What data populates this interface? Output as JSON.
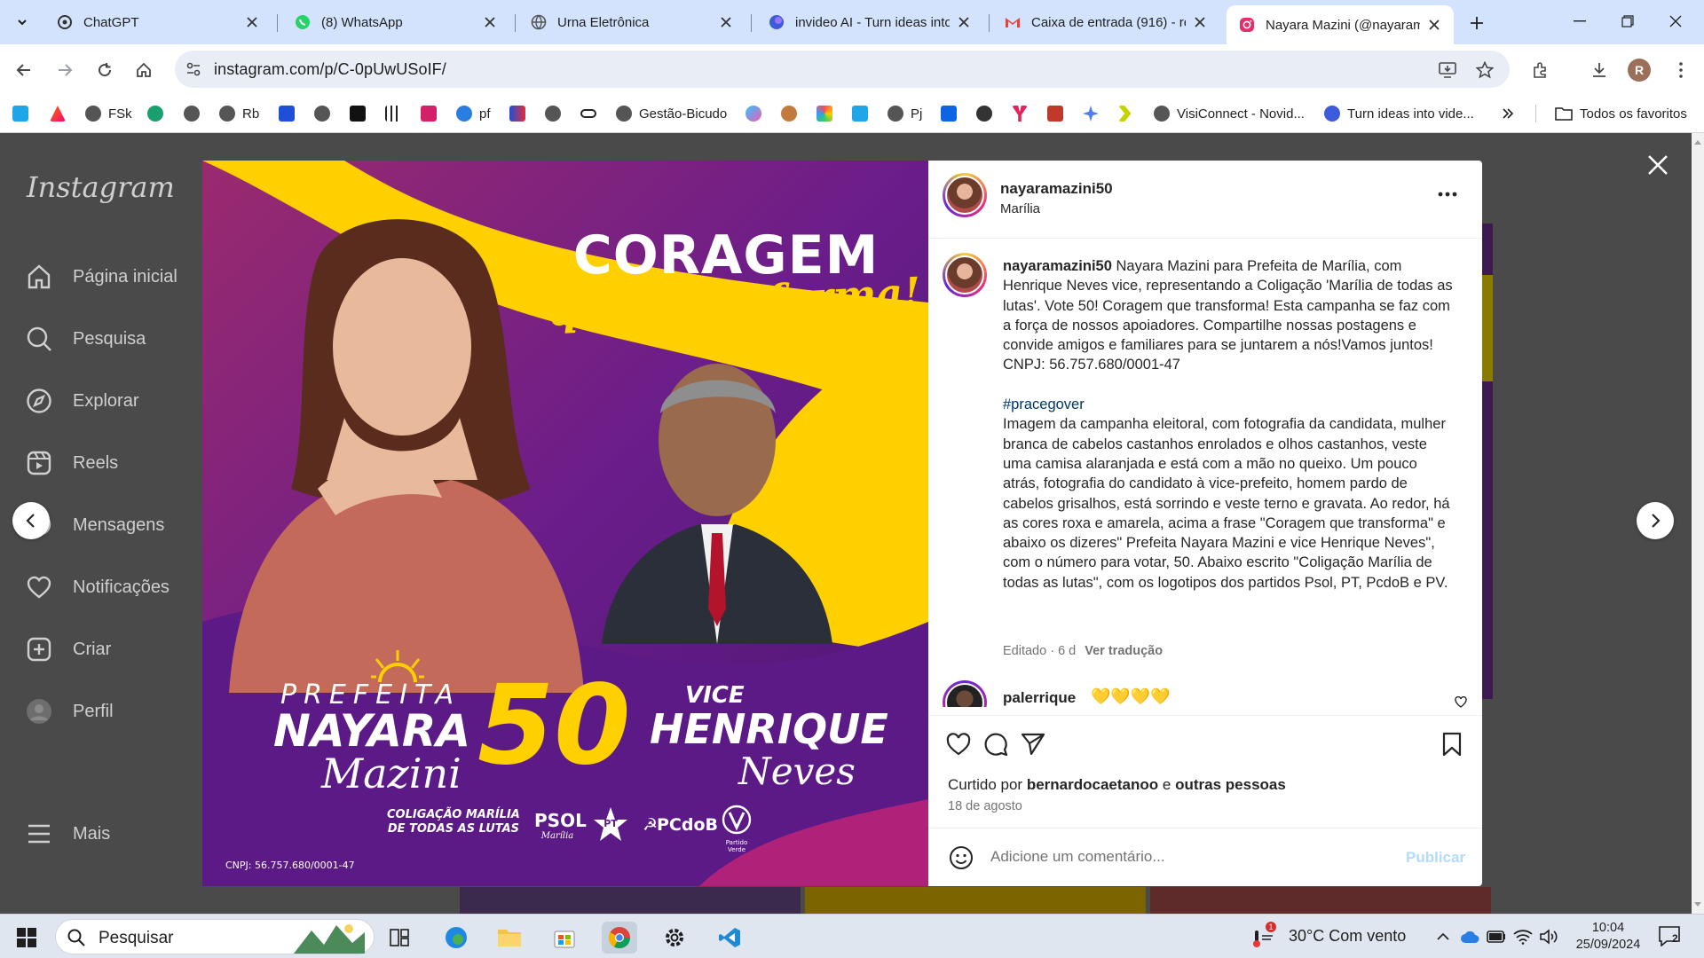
{
  "browser": {
    "tabs": [
      {
        "label": "ChatGPT",
        "icon": "chatgpt-icon"
      },
      {
        "label": "(8) WhatsApp",
        "icon": "whatsapp-icon"
      },
      {
        "label": "Urna Eletrônica",
        "icon": "globe-icon"
      },
      {
        "label": "invideo AI - Turn ideas into",
        "icon": "invideo-icon"
      },
      {
        "label": "Caixa de entrada (916) - re",
        "icon": "gmail-icon"
      },
      {
        "label": "Nayara Mazini (@nayaram",
        "icon": "instagram-icon"
      }
    ],
    "url": "instagram.com/p/C-0pUwUSoIF/",
    "profile_initial": "R"
  },
  "bookmarks": [
    {
      "label": "",
      "icon": "c-app-icon"
    },
    {
      "label": "",
      "icon": "triangle-icon"
    },
    {
      "label": "FSk",
      "icon": "globe-icon"
    },
    {
      "label": "",
      "icon": "cycle-icon"
    },
    {
      "label": "",
      "icon": "globe-icon"
    },
    {
      "label": "Rb",
      "icon": "globe-icon"
    },
    {
      "label": "",
      "icon": "u-icon"
    },
    {
      "label": "",
      "icon": "globe-icon"
    },
    {
      "label": "",
      "icon": "notion-icon"
    },
    {
      "label": "",
      "icon": "grid-icon"
    },
    {
      "label": "",
      "icon": "square-app-icon"
    },
    {
      "label": "pf",
      "icon": "p-icon"
    },
    {
      "label": "",
      "icon": "chart-icon"
    },
    {
      "label": "",
      "icon": "globe-icon"
    },
    {
      "label": "",
      "icon": "link-icon"
    },
    {
      "label": "Gestão-Bicudo",
      "icon": "globe-icon"
    },
    {
      "label": "",
      "icon": "copilot-icon"
    },
    {
      "label": "",
      "icon": "person-icon"
    },
    {
      "label": "",
      "icon": "colorgrid-icon"
    },
    {
      "label": "",
      "icon": "c-app-icon"
    },
    {
      "label": "Pj",
      "icon": "globe-icon"
    },
    {
      "label": "",
      "icon": "trello-icon"
    },
    {
      "label": "",
      "icon": "openai-icon"
    },
    {
      "label": "",
      "icon": "fork-icon"
    },
    {
      "label": "",
      "icon": "cap-icon"
    },
    {
      "label": "",
      "icon": "gemini-icon"
    },
    {
      "label": "",
      "icon": "chevrons-icon"
    },
    {
      "label": "VisiConnect - Novid...",
      "icon": "globe-icon"
    },
    {
      "label": "Turn ideas into vide...",
      "icon": "invideo-icon"
    }
  ],
  "bookmarks_all": "Todos os favoritos",
  "instagram": {
    "logo": "Instagram",
    "nav": [
      {
        "label": "Página inicial",
        "icon": "home-icon"
      },
      {
        "label": "Pesquisa",
        "icon": "search-icon"
      },
      {
        "label": "Explorar",
        "icon": "compass-icon"
      },
      {
        "label": "Reels",
        "icon": "reels-icon"
      },
      {
        "label": "Mensagens",
        "icon": "messenger-icon"
      },
      {
        "label": "Notificações",
        "icon": "heart-icon"
      },
      {
        "label": "Criar",
        "icon": "plus-square-icon"
      },
      {
        "label": "Perfil",
        "icon": "profile-avatar"
      }
    ],
    "more": "Mais"
  },
  "post": {
    "image": {
      "headline": "CORAGEM",
      "tagline": "que transforma!",
      "prefeita_label": "PREFEITA",
      "prefeita_first": "NAYARA",
      "prefeita_last": "Mazini",
      "number": "50",
      "vice_label": "VICE",
      "vice_first": "HENRIQUE",
      "vice_last": "Neves",
      "coalition_line1": "COLIGAÇÃO MARÍLIA",
      "coalition_line2": "DE TODAS AS LUTAS",
      "party_psol": "PSOL",
      "party_psol_sub": "Marília",
      "party_pt": "PT",
      "party_pcdob": "PCdoB",
      "party_pv_sub": "Partido Verde",
      "cnpj": "CNPJ: 56.757.680/0001-47"
    },
    "author": "nayaramazini50",
    "location": "Marília",
    "caption_user": "nayaramazini50",
    "caption_text": "Nayara Mazini para Prefeita de Marília, com Henrique Neves vice, representando a Coligação 'Marília de todas as lutas'. Vote 50! Coragem que transforma! Esta campanha se faz com a força de nossos apoiadores. Compartilhe nossas postagens e convide amigos e familiares para se juntarem a nós!Vamos juntos!",
    "caption_cnpj": "CNPJ: 56.757.680/0001-47",
    "hashtag": "#pracegover",
    "description": "Imagem da campanha eleitoral, com fotografia da candidata, mulher branca de cabelos castanhos enrolados e olhos castanhos, veste uma camisa alaranjada e está com a mão no queixo. Um pouco atrás, fotografia do candidato à vice-prefeito, homem pardo de cabelos grisalhos, está sorrindo e veste terno e gravata. Ao redor, há as cores roxa e amarela, acima a frase \"Coragem que transforma\" e abaixo os dizeres\" Prefeita Nayara Mazini e vice Henrique Neves\", com o número para votar, 50. Abaixo escrito \"Coligação Marília de todas as lutas\", com os logotipos dos partidos Psol, PT, PcdoB e PV.",
    "edited": "Editado · 6 d",
    "translate": "Ver tradução",
    "comment_user": "palerrique",
    "comment_text": "💛💛💛💛",
    "liked_prefix": "Curtido por",
    "liked_user": "bernardocaetanoo",
    "liked_and": "e",
    "liked_others": "outras pessoas",
    "date": "18 de agosto",
    "comment_placeholder": "Adicione um comentário...",
    "publish": "Publicar"
  },
  "taskbar": {
    "search": "Pesquisar",
    "weather": "30°C  Com vento",
    "time": "10:04",
    "date": "25/09/2024",
    "notification_count": "2",
    "weather_badge": "1"
  },
  "colors": {
    "accent_purple": "#6a1d8a",
    "accent_yellow": "#ffd000",
    "link_blue": "#00376b",
    "publish_disabled": "#b3dbff"
  }
}
